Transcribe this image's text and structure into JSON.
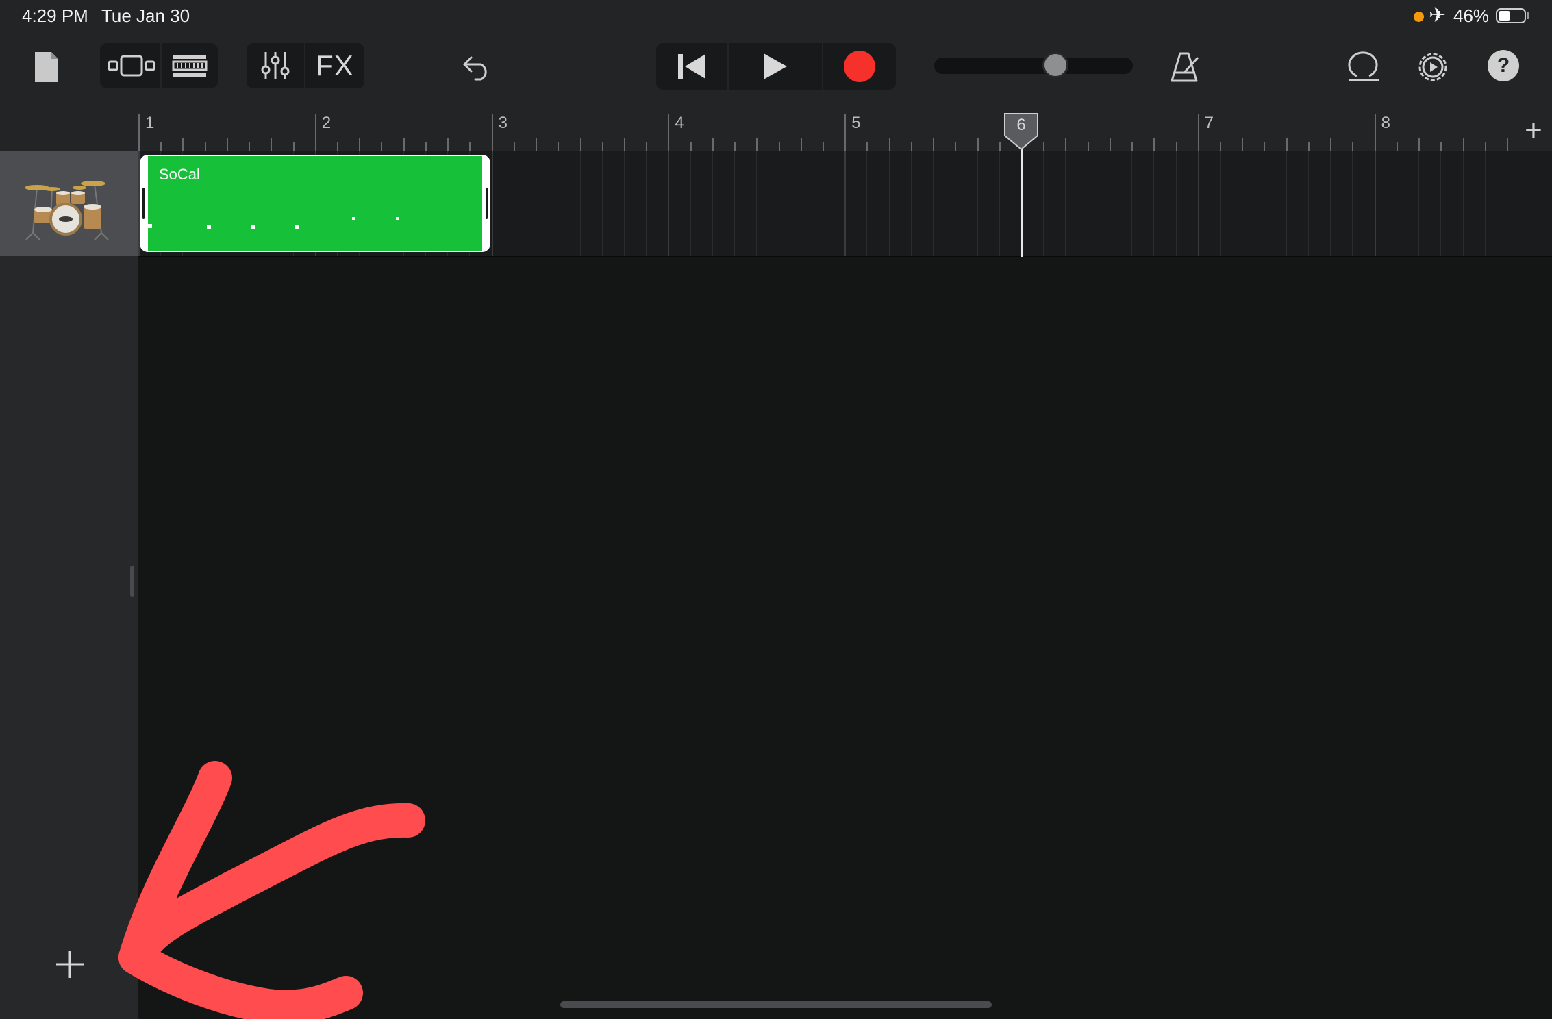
{
  "status_bar": {
    "time": "4:29 PM",
    "date": "Tue Jan 30",
    "airplane_icon": "airplane-icon",
    "battery_text": "46%",
    "battery_level": 0.46,
    "indicator_color": "#f59a0e"
  },
  "toolbar": {
    "my_songs_icon": "document-icon",
    "browser_icon": "browser-view-icon",
    "tracks_view_icon": "tracks-view-icon",
    "mixer_icon": "mixer-sliders-icon",
    "fx_label": "FX",
    "undo_icon": "undo-icon",
    "rewind_icon": "go-to-beginning-icon",
    "play_icon": "play-icon",
    "record_icon": "record-icon",
    "record_color": "#f6302b",
    "master_volume": 0.61,
    "metronome_icon": "metronome-icon",
    "loop_icon": "loop-icon",
    "settings_icon": "settings-icon",
    "help_label": "?"
  },
  "ruler": {
    "bars": [
      "1",
      "2",
      "3",
      "4",
      "5",
      "6",
      "7",
      "8"
    ],
    "add_section_label": "+"
  },
  "tracks": [
    {
      "instrument": "drums",
      "icon": "drum-kit-icon",
      "region": {
        "label": "SoCal",
        "color": "#16c039",
        "start_bar": 1,
        "length_bars": 2
      }
    }
  ],
  "playhead": {
    "bar": 6
  },
  "add_track_label": "+",
  "annotation": {
    "color": "#ff4d4f",
    "points_to": "add-track-button"
  }
}
